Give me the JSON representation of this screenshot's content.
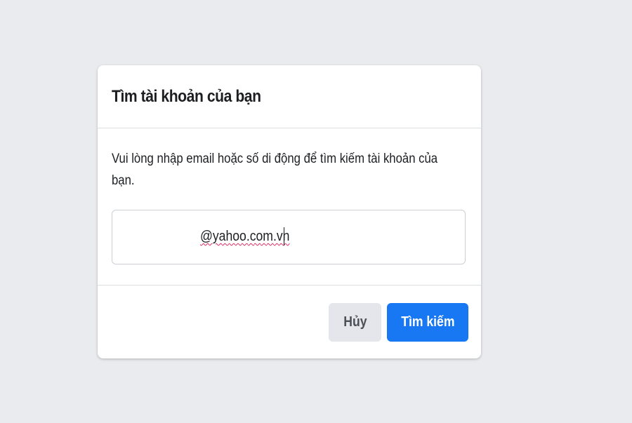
{
  "dialog": {
    "title": "Tìm tài khoản của bạn",
    "instructions": "Vui lòng nhập email hoặc số di động để tìm kiếm tài khoản của bạn.",
    "input": {
      "value": "@yahoo.com.vn"
    },
    "cancel_label": "Hủy",
    "search_label": "Tìm kiếm"
  },
  "colors": {
    "background": "#e9ebee",
    "primary_button": "#1877f2",
    "secondary_button": "#e4e6eb"
  }
}
